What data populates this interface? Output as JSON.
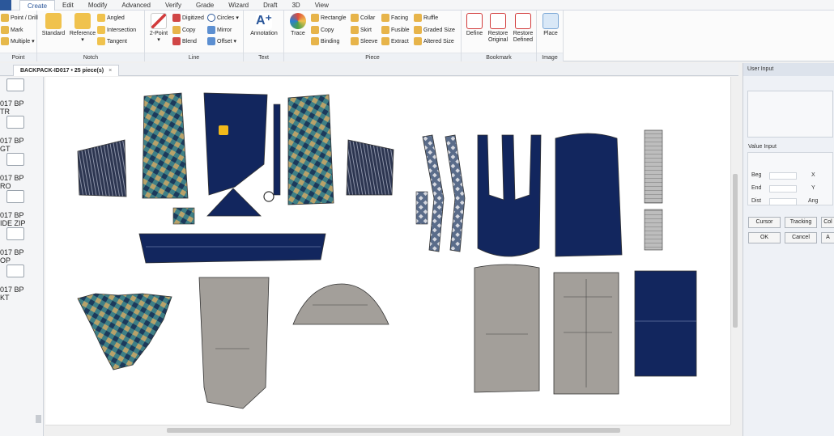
{
  "menu": {
    "tabs": [
      "Create",
      "Edit",
      "Modify",
      "Advanced",
      "Verify",
      "Grade",
      "Wizard",
      "Draft",
      "3D",
      "View"
    ],
    "active": "Create"
  },
  "ribbon": {
    "point": {
      "label": "Point",
      "items": [
        "Point / Drill",
        "Mark",
        "Multiple"
      ]
    },
    "notch": {
      "label": "Notch",
      "standard": "Standard",
      "reference": "Reference",
      "items": [
        "Angled",
        "Intersection",
        "Tangent"
      ]
    },
    "line": {
      "label": "Line",
      "two_point": "2-Point",
      "items": [
        "Digitized",
        "Copy",
        "Blend",
        "Circles",
        "Mirror",
        "Offset"
      ]
    },
    "text": {
      "label": "Text",
      "annotation": "Annotation"
    },
    "piece": {
      "label": "Piece",
      "trace": "Trace",
      "items": [
        "Rectangle",
        "Copy",
        "Binding",
        "Collar",
        "Skirt",
        "Sleeve",
        "Facing",
        "Fusible",
        "Extract",
        "Ruffle",
        "Graded Size",
        "Altered Size"
      ]
    },
    "bookmark": {
      "label": "Bookmark",
      "define": "Define",
      "restore_original": "Restore Original",
      "restore_defined": "Restore Defined"
    },
    "image": {
      "label": "Image",
      "place": "Place"
    }
  },
  "document": {
    "tab_title": "BACKPACK-ID017 • 25 piece(s)",
    "close": "×"
  },
  "piece_list": [
    {
      "line1": "017 BP",
      "line2": "TR"
    },
    {
      "line1": "017 BP",
      "line2": "GT"
    },
    {
      "line1": "017 BP",
      "line2": "RO"
    },
    {
      "line1": "017 BP",
      "line2": "IDE ZIP"
    },
    {
      "line1": "017 BP",
      "line2": "OP"
    },
    {
      "line1": "017 BP",
      "line2": "KT"
    }
  ],
  "user_input": {
    "title": "User Input",
    "value_input": "Value Input",
    "rows": [
      {
        "label": "Beg",
        "axis": "X"
      },
      {
        "label": "End",
        "axis": "Y"
      },
      {
        "label": "Dist",
        "axis": "Ang"
      }
    ],
    "buttons": [
      "Cursor",
      "Tracking",
      "Col"
    ],
    "ok": "OK",
    "cancel": "Cancel",
    "apply": "A"
  },
  "colors": {
    "navy": "#12265e",
    "gray_piece": "#a39f9a",
    "pattern_teal": "#3e7f86",
    "pattern_gold": "#b8a26a",
    "accent_blue": "#2b579a",
    "marker": "#f2b91a"
  }
}
